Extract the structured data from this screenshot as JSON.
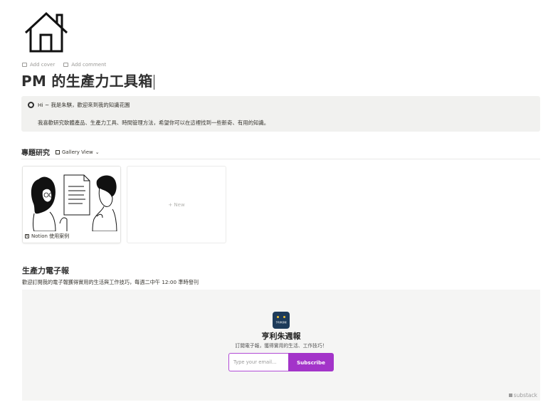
{
  "page": {
    "icon": "house-icon",
    "cover_actions": [
      {
        "label": "Add cover",
        "icon": "image-icon"
      },
      {
        "label": "Add comment",
        "icon": "comment-icon"
      }
    ],
    "title": "PM 的生產力工具箱"
  },
  "callout": {
    "greeting": "Hi ~ 我是朱騏，歡迎來到我的知識花園",
    "body": "我喜歡研究軟體產品、生產力工具、時間管理方法，希望你可以在這裡找到一些新奇、有用的知識。"
  },
  "gallery": {
    "heading": "專題研究",
    "view_label": "Gallery View",
    "cards": [
      {
        "title": "Notion 使用案例",
        "icon": "notion-icon"
      }
    ],
    "new_label": "+ New"
  },
  "newsletter": {
    "heading": "生產力電子報",
    "description": "歡迎訂閱我的電子報獲得實用的生活與工作技巧，每週二中午 12:00 準時發刊",
    "publication": "亨利朱週報",
    "tagline": "訂閱電子報，獲得實用的生活、工作技巧！",
    "email_placeholder": "Type your email...",
    "subscribe_label": "Subscribe",
    "brand": "substack",
    "accent_color": "#a334c9"
  }
}
